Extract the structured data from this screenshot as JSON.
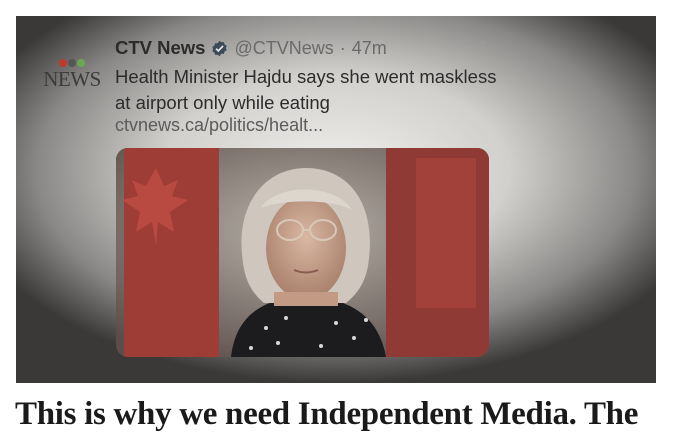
{
  "tweet": {
    "account_name": "CTV News",
    "handle": "@CTVNews",
    "separator": "·",
    "time": "47m",
    "more_label": "•••",
    "logo_text": "NEWS",
    "headline": "Health Minister Hajdu says she went maskless at airport only while eating",
    "link": "ctvnews.ca/politics/healt...",
    "icons": {
      "verified": "verified-badge-icon",
      "more": "more-options-icon",
      "logo": "ctv-logo-icon"
    }
  },
  "article": {
    "title": "This is why we need Independent Media. The"
  },
  "colors": {
    "flag_red": "#a13b34",
    "background": "#ffffff",
    "title": "#1a1a1a"
  }
}
